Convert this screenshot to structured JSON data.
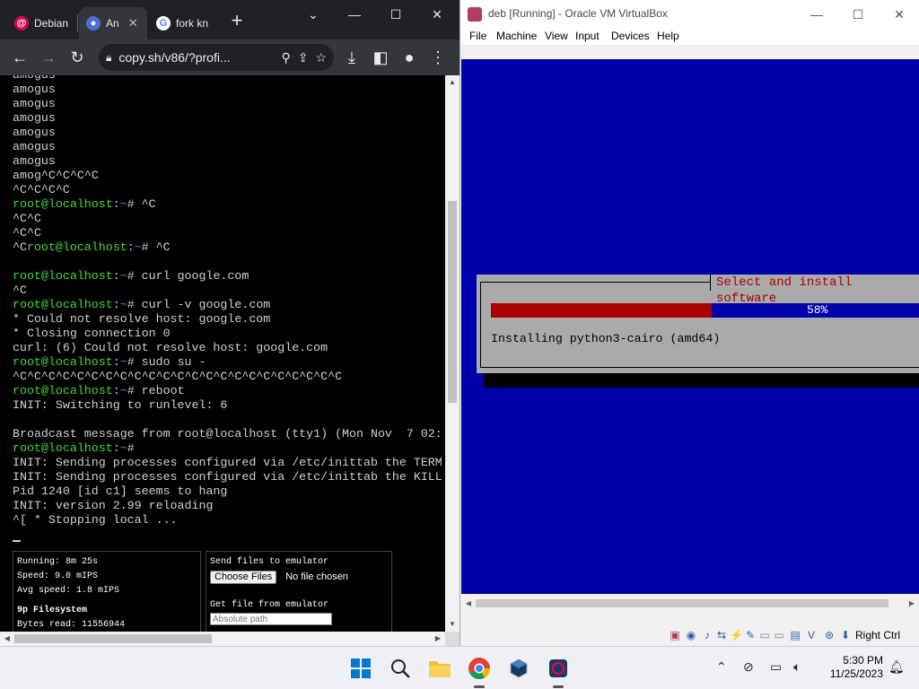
{
  "chrome": {
    "tabs": [
      {
        "label": "Debian"
      },
      {
        "label": "An"
      },
      {
        "label": "fork kn"
      }
    ],
    "new_tab": "+",
    "url": "copy.sh/v86/?profi...",
    "terminal": {
      "lines": [
        [
          {
            "t": "amogus"
          }
        ],
        [
          {
            "t": "amogus"
          }
        ],
        [
          {
            "t": "amogus"
          }
        ],
        [
          {
            "t": "amogus"
          }
        ],
        [
          {
            "t": "amogus"
          }
        ],
        [
          {
            "t": "amogus"
          }
        ],
        [
          {
            "t": "amogus"
          }
        ],
        [
          {
            "t": "amog^C^C^C^C"
          }
        ],
        [
          {
            "t": "^C^C^C^C"
          }
        ],
        [
          {
            "t": "root@localhost",
            "c": "prompt"
          },
          {
            "t": ":"
          },
          {
            "t": "~",
            "c": "tilde"
          },
          {
            "t": "# ^C"
          }
        ],
        [
          {
            "t": "^C^C"
          }
        ],
        [
          {
            "t": "^C^C"
          }
        ],
        [
          {
            "t": "^C"
          },
          {
            "t": "root@localhost",
            "c": "prompt"
          },
          {
            "t": ":"
          },
          {
            "t": "~",
            "c": "tilde"
          },
          {
            "t": "# ^C"
          }
        ],
        [
          {
            "t": ""
          }
        ],
        [
          {
            "t": "root@localhost",
            "c": "prompt"
          },
          {
            "t": ":"
          },
          {
            "t": "~",
            "c": "tilde"
          },
          {
            "t": "# curl google.com"
          }
        ],
        [
          {
            "t": "^C"
          }
        ],
        [
          {
            "t": "root@localhost",
            "c": "prompt"
          },
          {
            "t": ":"
          },
          {
            "t": "~",
            "c": "tilde"
          },
          {
            "t": "# curl -v google.com"
          }
        ],
        [
          {
            "t": "* Could not resolve host: google.com"
          }
        ],
        [
          {
            "t": "* Closing connection 0"
          }
        ],
        [
          {
            "t": "curl: (6) Could not resolve host: google.com"
          }
        ],
        [
          {
            "t": "root@localhost",
            "c": "prompt"
          },
          {
            "t": ":"
          },
          {
            "t": "~",
            "c": "tilde"
          },
          {
            "t": "# sudo su -"
          }
        ],
        [
          {
            "t": "^C^C^C^C^C^C^C^C^C^C^C^C^C^C^C^C^C^C^C^C^C^C^C"
          }
        ],
        [
          {
            "t": "root@localhost",
            "c": "prompt"
          },
          {
            "t": ":"
          },
          {
            "t": "~",
            "c": "tilde"
          },
          {
            "t": "# reboot"
          }
        ],
        [
          {
            "t": "INIT: Switching to runlevel: 6"
          }
        ],
        [
          {
            "t": ""
          }
        ],
        [
          {
            "t": "Broadcast message from root@localhost (tty1) (Mon Nov  7 02:"
          }
        ],
        [
          {
            "t": "root@localhost",
            "c": "prompt"
          },
          {
            "t": ":"
          },
          {
            "t": "~",
            "c": "tilde"
          },
          {
            "t": "#"
          }
        ],
        [
          {
            "t": "INIT: Sending processes configured via /etc/inittab the TERM"
          }
        ],
        [
          {
            "t": "INIT: Sending processes configured via /etc/inittab the KILL"
          }
        ],
        [
          {
            "t": "Pid 1240 [id c1] seems to hang"
          }
        ],
        [
          {
            "t": "INIT: version 2.99 reloading"
          }
        ],
        [
          {
            "t": "^[ * Stopping local ..."
          }
        ]
      ]
    },
    "stats": {
      "running": "Running: 8m 25s",
      "speed": "Speed: 9.0 mIPS",
      "avg_speed": "Avg speed: 1.8 mIPS",
      "fs_heading": "9p Filesystem",
      "bytes_read": "Bytes read: 11556944"
    },
    "files": {
      "send_heading": "Send files to emulator",
      "choose_label": "Choose Files",
      "no_file": "No file chosen",
      "get_heading": "Get file from emulator",
      "path_placeholder": "Absolute path"
    }
  },
  "vbox": {
    "title": "deb [Running] - Oracle VM VirtualBox",
    "menu": [
      "File",
      "Machine",
      "View",
      "Input",
      "Devices",
      "Help"
    ],
    "dialog_title": "Select and install software",
    "progress_percent": 58,
    "progress_label": "58%",
    "message": "Installing python3-cairo (amd64)",
    "host_key": "Right Ctrl"
  },
  "taskbar": {
    "time": "5:30 PM",
    "date": "11/25/2023"
  }
}
